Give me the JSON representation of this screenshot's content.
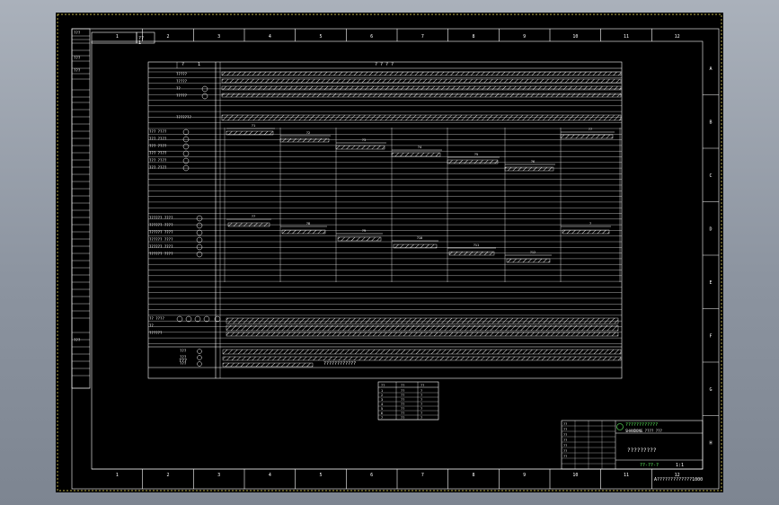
{
  "colors": {
    "background": "#000000",
    "line": "#ffffff",
    "accent_green": "#66ff66",
    "accent_cyan": "#88ffff",
    "accent_red": "#ff5555",
    "viewport": "#8e96a2"
  },
  "frame": {
    "col_numbers": [
      "1",
      "2",
      "3",
      "4",
      "5",
      "6",
      "7",
      "8",
      "9",
      "10",
      "11",
      "12"
    ],
    "row_letters": [
      "A",
      "B",
      "C",
      "D",
      "E",
      "F",
      "G",
      "H"
    ]
  },
  "top_left_box": {
    "line1": "??",
    "line2": "1"
  },
  "cycle_chart": {
    "header_col1": "?",
    "header_col2": "1",
    "header_main": "? ? ? ?",
    "top_rows": [
      "?????",
      "?????",
      "??",
      "?????",
      "???????"
    ],
    "cylinder_rows": [
      "??? ????",
      "??? ????",
      "??? ????",
      "??? ????",
      "??? ????",
      "??? ????"
    ],
    "valve_rows": [
      "?????? ????",
      "?????? ????",
      "?????? ????",
      "?????? ????",
      "?????? ????",
      "?????? ????"
    ],
    "bottom_rows": [
      "?? ????",
      "??",
      "??????"
    ],
    "footer_rows": [
      "???",
      "???",
      "???"
    ],
    "footer_side": "???",
    "time_labels": [
      "?1",
      "?2",
      "?3",
      "?4",
      "?5",
      "?6",
      "?7",
      "?8",
      "?9",
      "?10",
      "?11",
      "?12"
    ],
    "hatch_text": "????????????"
  },
  "small_table": {
    "headers": [
      "??",
      "??",
      "??"
    ],
    "rows": [
      [
        "1",
        "??",
        "?"
      ],
      [
        "2",
        "??",
        "?"
      ],
      [
        "3",
        "??",
        "?"
      ],
      [
        "4",
        "??",
        "?"
      ],
      [
        "5",
        "??",
        "?"
      ],
      [
        "6",
        "??",
        "?"
      ],
      [
        "7",
        "??",
        "?"
      ]
    ]
  },
  "left_strip": {
    "labels": [
      "???",
      "???",
      "???",
      "???"
    ]
  },
  "title_block": {
    "company": "????????????",
    "company_en": "SHANDONG ???? ???",
    "drawing_name": "?????????",
    "drawing_no": "??-??-?",
    "scale": "1:1",
    "row_labels": [
      "??",
      "??",
      "??",
      "??",
      "??",
      "??",
      "??"
    ]
  },
  "bottom_note": "A?????????????1000"
}
